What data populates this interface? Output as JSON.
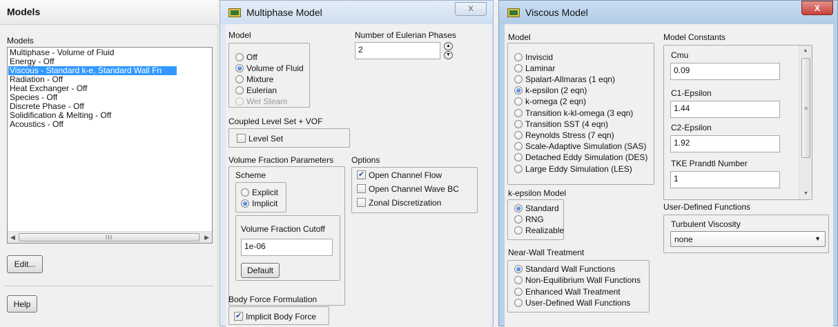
{
  "models_panel": {
    "title": "Models",
    "list_label": "Models",
    "items": [
      "Multiphase - Volume of Fluid",
      "Energy - Off",
      "Viscous - Standard k-e, Standard Wall Fn",
      "Radiation - Off",
      "Heat Exchanger - Off",
      "Species - Off",
      "Discrete Phase - Off",
      "Solidification & Melting - Off",
      "Acoustics - Off"
    ],
    "selected_index": 2,
    "scroll_thumb_glyph": "III",
    "edit_label": "Edit...",
    "help_label": "Help"
  },
  "multiphase": {
    "title": "Multiphase Model",
    "close_glyph": "X",
    "model_label": "Model",
    "models": [
      "Off",
      "Volume of Fluid",
      "Mixture",
      "Eulerian",
      "Wet Steam"
    ],
    "model_selected": 1,
    "model_disabled": 4,
    "phases_label": "Number of Eulerian Phases",
    "phases_value": "2",
    "coupled_label": "Coupled Level Set + VOF",
    "level_set_label": "Level Set",
    "vfp_label": "Volume Fraction Parameters",
    "scheme_label": "Scheme",
    "schemes": [
      "Explicit",
      "Implicit"
    ],
    "scheme_selected": 1,
    "cutoff_label": "Volume Fraction Cutoff",
    "cutoff_value": "1e-06",
    "default_label": "Default",
    "options_label": "Options",
    "options": [
      {
        "label": "Open Channel Flow",
        "checked": true
      },
      {
        "label": "Open Channel Wave BC",
        "checked": false
      },
      {
        "label": "Zonal Discretization",
        "checked": false
      }
    ],
    "body_force_label": "Body Force Formulation",
    "implicit_body_force_label": "Implicit Body Force",
    "implicit_body_force_checked": true
  },
  "viscous": {
    "title": "Viscous Model",
    "close_glyph": "X",
    "model_label": "Model",
    "models": [
      "Inviscid",
      "Laminar",
      "Spalart-Allmaras (1 eqn)",
      "k-epsilon (2 eqn)",
      "k-omega (2 eqn)",
      "Transition k-kl-omega (3 eqn)",
      "Transition SST (4 eqn)",
      "Reynolds Stress (7 eqn)",
      "Scale-Adaptive Simulation (SAS)",
      "Detached Eddy Simulation (DES)",
      "Large Eddy Simulation (LES)"
    ],
    "model_selected": 3,
    "ke_label": "k-epsilon Model",
    "ke_models": [
      "Standard",
      "RNG",
      "Realizable"
    ],
    "ke_selected": 0,
    "nwt_label": "Near-Wall Treatment",
    "nwt_options": [
      "Standard Wall Functions",
      "Non-Equilibrium Wall Functions",
      "Enhanced Wall Treatment",
      "User-Defined Wall Functions"
    ],
    "nwt_selected": 0,
    "constants_label": "Model Constants",
    "constants": [
      {
        "label": "Cmu",
        "value": "0.09"
      },
      {
        "label": "C1-Epsilon",
        "value": "1.44"
      },
      {
        "label": "C2-Epsilon",
        "value": "1.92"
      },
      {
        "label": "TKE Prandtl Number",
        "value": "1"
      }
    ],
    "udf_label": "User-Defined Functions",
    "turb_visc_label": "Turbulent Viscosity",
    "turb_visc_value": "none",
    "scroll_grip": "≡"
  },
  "colors": {
    "selection": "#3399ff",
    "title_active": "#c7dcf2",
    "title_inactive": "#dfe9f5",
    "close_red": "#c8413a",
    "window_frame": "#b9d1ea"
  }
}
